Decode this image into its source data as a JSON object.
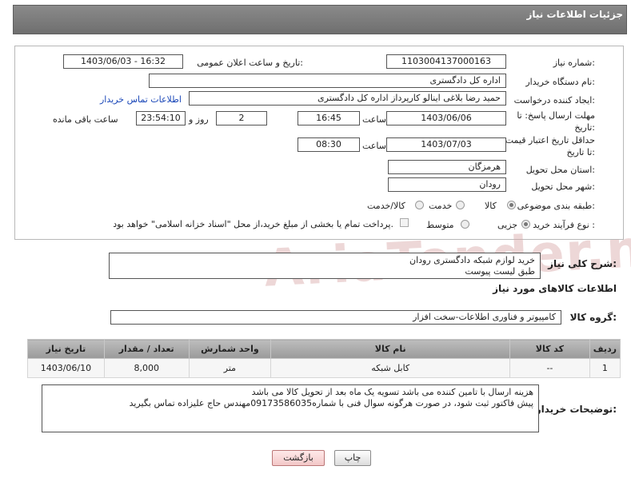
{
  "header": {
    "title": "جزئیات اطلاعات نیاز"
  },
  "form": {
    "need_number_label": "شماره نیاز:",
    "need_number": "1103004137000163",
    "announce_label": "تاریخ و ساعت اعلان عمومی:",
    "announce_value": "1403/06/03 - 16:32",
    "buyer_label": "نام دستگاه خریدار:",
    "buyer_value": "اداره کل دادگستری",
    "creator_label": "ایجاد کننده درخواست:",
    "creator_value": "حمید رضا  بلاغی اینالو کارپرداز اداره کل دادگستری",
    "contact_link": "اطلاعات تماس خریدار",
    "reply_deadline_label": "مهلت ارسال پاسخ: تا تاریخ:",
    "reply_date": "1403/06/06",
    "time_label": "ساعت",
    "reply_time": "16:45",
    "days_value": "2",
    "days_label": "روز و",
    "remaining_time": "23:54:10",
    "remaining_label": "ساعت باقی مانده",
    "validity_label": "حداقل تاریخ اعتبار قیمت: تا تاریخ:",
    "validity_date": "1403/07/03",
    "validity_time_label": "ساعت",
    "validity_time": "08:30",
    "province_label": "استان محل تحویل:",
    "province_value": "هرمزگان",
    "city_label": "شهر محل تحویل:",
    "city_value": "رودان",
    "category_label": "طبقه بندی موضوعی:",
    "category_options": [
      "کالا",
      "خدمت",
      "کالا/خدمت"
    ],
    "category_selected": "کالا",
    "process_label": "نوع فرآیند خرید :",
    "process_options": [
      "جزیی",
      "متوسط"
    ],
    "process_selected": "جزیی",
    "payment_note": "پرداخت تمام یا بخشی از مبلغ خرید،از محل \"اسناد خزانه اسلامی\" خواهد بود."
  },
  "general": {
    "description_label": "شرح کلی نیاز:",
    "description_line1": "خرید لوازم شبکه دادگستری رودان",
    "description_line2": "طبق لیست پیوست"
  },
  "goods": {
    "section_title": "اطلاعات کالاهای مورد نیاز",
    "group_label": "گروه کالا:",
    "group_value": "کامپیوتر و فناوری اطلاعات-سخت افزار",
    "columns": [
      "ردیف",
      "کد کالا",
      "نام کالا",
      "واحد شمارش",
      "تعداد / مقدار",
      "تاریخ نیاز"
    ],
    "rows": [
      {
        "row": "1",
        "code": "--",
        "name": "کابل شبکه",
        "unit": "متر",
        "qty": "8,000",
        "date": "1403/06/10"
      }
    ]
  },
  "buyer_notes": {
    "label": "توضیحات خریدار:",
    "line1": "هزینه ارسال با تامین کننده می باشد تسویه یک ماه بعد از تحویل کالا می باشد",
    "line2": "پیش فاکتور ثبت شود، در صورت هرگونه سوال فنی با شماره09173586035مهندس حاج علیزاده تماس بگیرید"
  },
  "actions": {
    "print": "چاپ",
    "back": "بازگشت"
  },
  "watermark": {
    "text": "AriaTender.neT"
  },
  "colors": {
    "header": "#7a7a7a",
    "link": "#1a47b8",
    "back_button": "#f3c8c8"
  }
}
